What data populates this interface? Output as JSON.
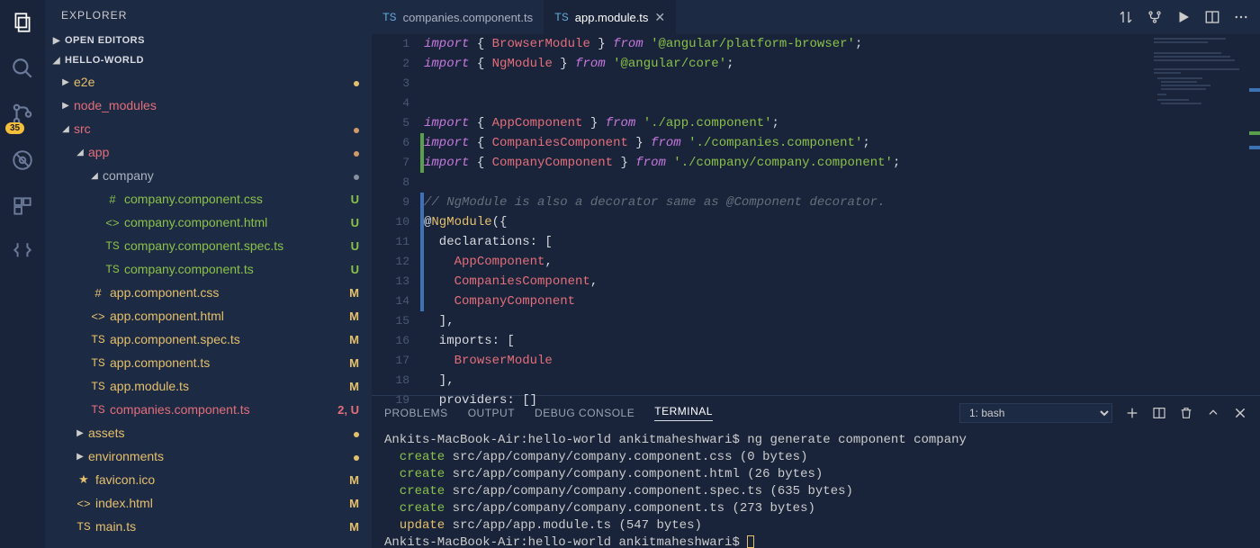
{
  "activity": {
    "badge": "35"
  },
  "sidebar": {
    "title": "EXPLORER",
    "openEditors": "OPEN EDITORS",
    "project": "HELLO-WORLD",
    "tree": {
      "e2e": "e2e",
      "node_modules": "node_modules",
      "src": "src",
      "app": "app",
      "company": "company",
      "company_css": "company.component.css",
      "company_html": "company.component.html",
      "company_spec": "company.component.spec.ts",
      "company_ts": "company.component.ts",
      "app_css": "app.component.css",
      "app_html": "app.component.html",
      "app_spec": "app.component.spec.ts",
      "app_ts": "app.component.ts",
      "app_module": "app.module.ts",
      "companies_ts": "companies.component.ts",
      "assets": "assets",
      "environments": "environments",
      "favicon": "favicon.ico",
      "index": "index.html",
      "main": "main.ts"
    },
    "status": {
      "U": "U",
      "M": "M",
      "twoU": "2, U"
    }
  },
  "tabs": {
    "companies": "companies.component.ts",
    "appmodule": "app.module.ts",
    "ts": "TS"
  },
  "panel": {
    "problems": "PROBLEMS",
    "output": "OUTPUT",
    "debug": "DEBUG CONSOLE",
    "terminal": "TERMINAL",
    "select": "1: bash"
  },
  "terminal": {
    "l0": "Ankits-MacBook-Air:hello-world ankitmaheshwari$ ng generate component company",
    "l1a": "  create",
    "l1b": " src/app/company/company.component.css (0 bytes)",
    "l2a": "  create",
    "l2b": " src/app/company/company.component.html (26 bytes)",
    "l3a": "  create",
    "l3b": " src/app/company/company.component.spec.ts (635 bytes)",
    "l4a": "  create",
    "l4b": " src/app/company/company.component.ts (273 bytes)",
    "l5a": "  update",
    "l5b": " src/app/app.module.ts (547 bytes)",
    "l6": "Ankits-MacBook-Air:hello-world ankitmaheshwari$ "
  },
  "code": {
    "lines": [
      [
        {
          "t": "import",
          "c": "kw"
        },
        {
          "t": " { ",
          "c": "p"
        },
        {
          "t": "BrowserModule",
          "c": "id"
        },
        {
          "t": " } ",
          "c": "p"
        },
        {
          "t": "from",
          "c": "kw"
        },
        {
          "t": " ",
          "c": "p"
        },
        {
          "t": "'@angular/platform-browser'",
          "c": "str"
        },
        {
          "t": ";",
          "c": "p"
        }
      ],
      [
        {
          "t": "import",
          "c": "kw"
        },
        {
          "t": " { ",
          "c": "p"
        },
        {
          "t": "NgModule",
          "c": "id"
        },
        {
          "t": " } ",
          "c": "p"
        },
        {
          "t": "from",
          "c": "kw"
        },
        {
          "t": " ",
          "c": "p"
        },
        {
          "t": "'@angular/core'",
          "c": "str"
        },
        {
          "t": ";",
          "c": "p"
        }
      ],
      [],
      [],
      [
        {
          "t": "import",
          "c": "kw"
        },
        {
          "t": " { ",
          "c": "p"
        },
        {
          "t": "AppComponent",
          "c": "id"
        },
        {
          "t": " } ",
          "c": "p"
        },
        {
          "t": "from",
          "c": "kw"
        },
        {
          "t": " ",
          "c": "p"
        },
        {
          "t": "'./app.component'",
          "c": "str"
        },
        {
          "t": ";",
          "c": "p"
        }
      ],
      [
        {
          "t": "import",
          "c": "kw"
        },
        {
          "t": " { ",
          "c": "p"
        },
        {
          "t": "CompaniesComponent",
          "c": "id"
        },
        {
          "t": " } ",
          "c": "p"
        },
        {
          "t": "from",
          "c": "kw"
        },
        {
          "t": " ",
          "c": "p"
        },
        {
          "t": "'./companies.component'",
          "c": "str"
        },
        {
          "t": ";",
          "c": "p"
        }
      ],
      [
        {
          "t": "import",
          "c": "kw"
        },
        {
          "t": " { ",
          "c": "p"
        },
        {
          "t": "CompanyComponent",
          "c": "id"
        },
        {
          "t": " } ",
          "c": "p"
        },
        {
          "t": "from",
          "c": "kw"
        },
        {
          "t": " ",
          "c": "p"
        },
        {
          "t": "'./company/company.component'",
          "c": "str"
        },
        {
          "t": ";",
          "c": "p"
        }
      ],
      [],
      [
        {
          "t": "// NgModule is also a decorator same as @Component decorator.",
          "c": "cm"
        }
      ],
      [
        {
          "t": "@",
          "c": "p"
        },
        {
          "t": "NgModule",
          "c": "dec"
        },
        {
          "t": "({",
          "c": "p"
        }
      ],
      [
        {
          "t": "  declarations: [",
          "c": "p"
        }
      ],
      [
        {
          "t": "    ",
          "c": "p"
        },
        {
          "t": "AppComponent",
          "c": "id"
        },
        {
          "t": ",",
          "c": "p"
        }
      ],
      [
        {
          "t": "    ",
          "c": "p"
        },
        {
          "t": "CompaniesComponent",
          "c": "id"
        },
        {
          "t": ",",
          "c": "p"
        }
      ],
      [
        {
          "t": "    ",
          "c": "p"
        },
        {
          "t": "CompanyComponent",
          "c": "id"
        }
      ],
      [
        {
          "t": "  ],",
          "c": "p"
        }
      ],
      [
        {
          "t": "  imports: [",
          "c": "p"
        }
      ],
      [
        {
          "t": "    ",
          "c": "p"
        },
        {
          "t": "BrowserModule",
          "c": "id"
        }
      ],
      [
        {
          "t": "  ],",
          "c": "p"
        }
      ],
      [
        {
          "t": "  providers: []",
          "c": "p"
        }
      ]
    ],
    "gutterMarks": {
      "6": "green",
      "7": "green",
      "9": "blue",
      "10": "blue",
      "11": "blue",
      "12": "blue",
      "13": "blue",
      "14": "blue"
    }
  }
}
